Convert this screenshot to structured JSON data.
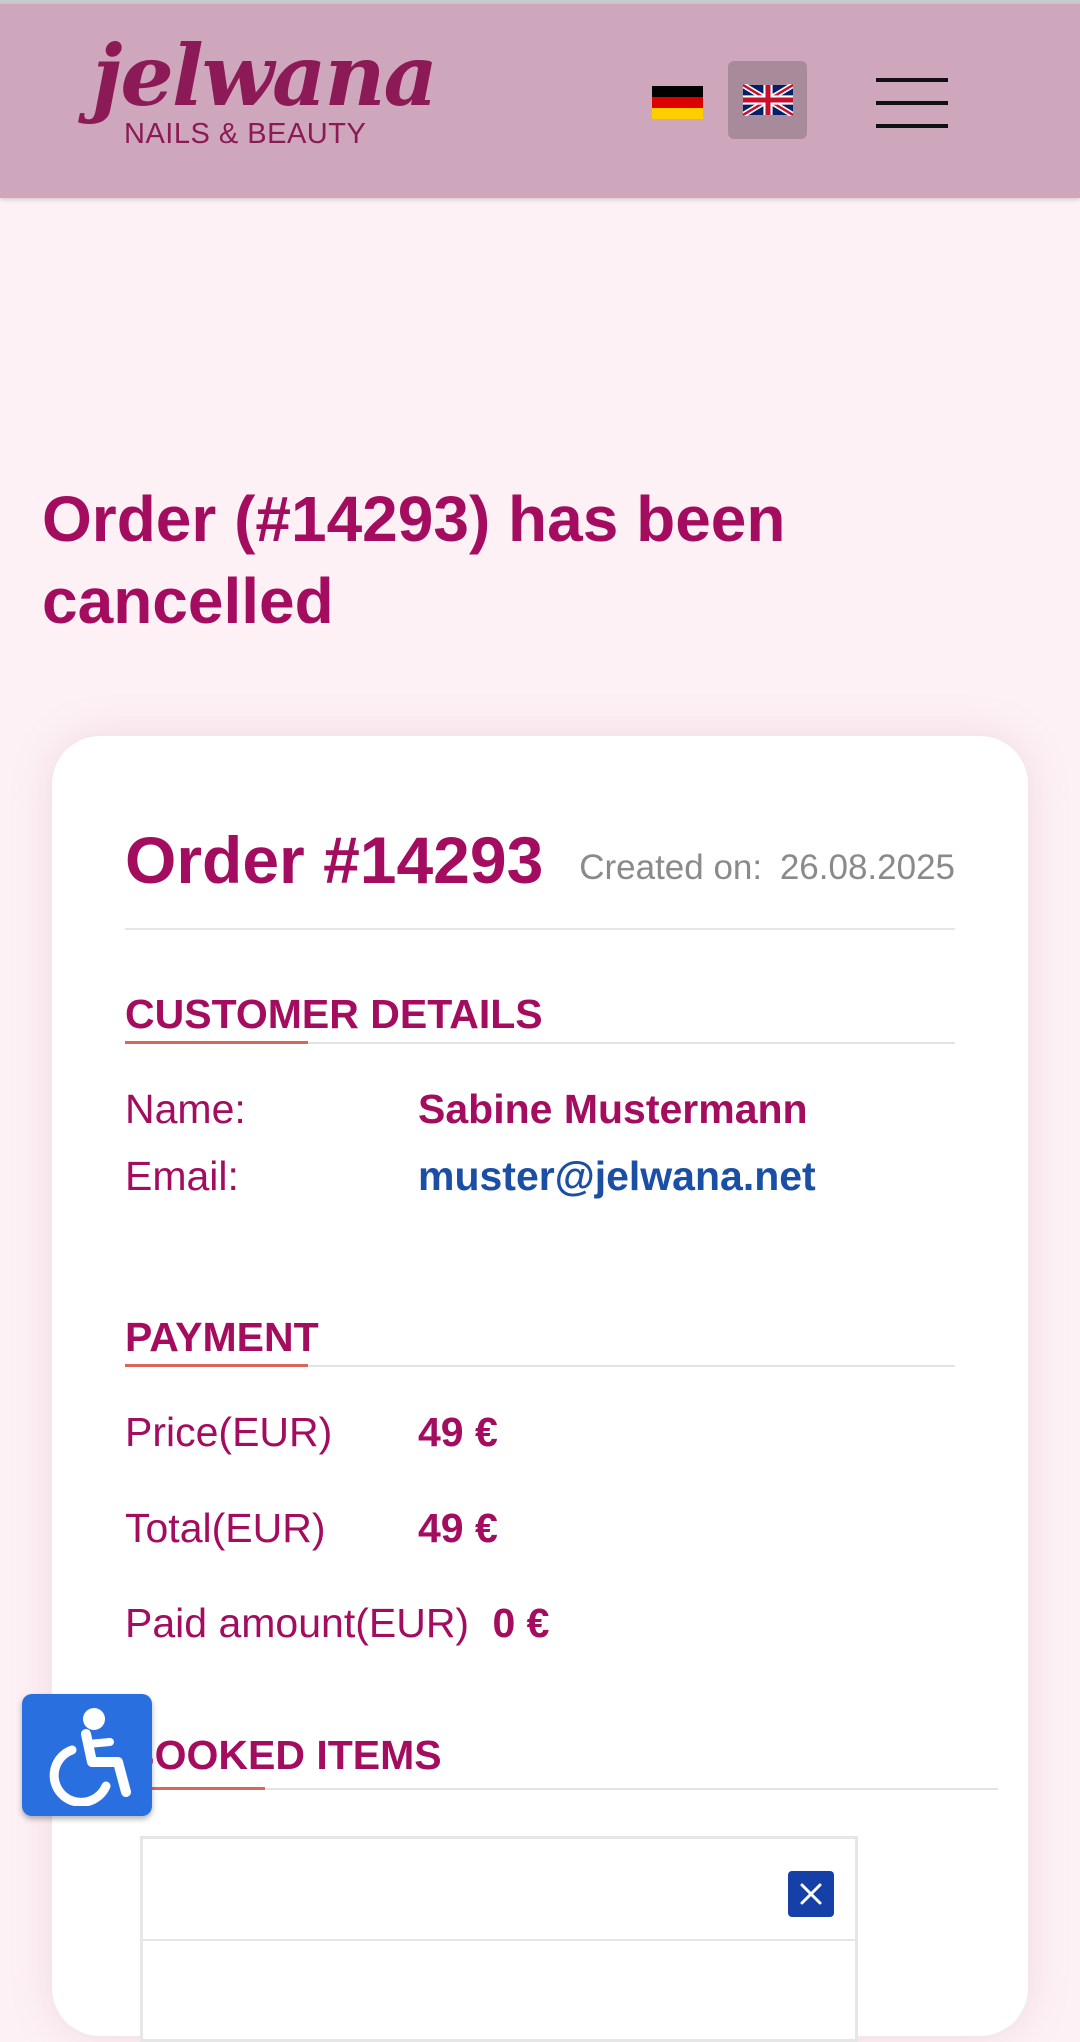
{
  "header": {
    "logo_word": "jelwana",
    "logo_sub": "NAILS & BEAUTY",
    "languages": [
      "german-flag",
      "english-flag"
    ],
    "active_language": "english-flag",
    "menu_icon": "hamburger-menu-icon"
  },
  "page": {
    "title": "Order (#14293) has been cancelled"
  },
  "order": {
    "number": "Order #14293",
    "created_label": "Created on:",
    "created_date": "26.08.2025"
  },
  "customer": {
    "section_title": "CUSTOMER DETAILS",
    "name_label": "Name:",
    "name_value": "Sabine Mustermann",
    "email_label": "Email:",
    "email_value": "muster@jelwana.net"
  },
  "payment": {
    "section_title": "PAYMENT",
    "price_label": "Price(EUR)",
    "price_value": "49 €",
    "total_label": "Total(EUR)",
    "total_value": "49 €",
    "paid_label": "Paid amount(EUR)",
    "paid_value": "0 €"
  },
  "booked": {
    "section_title": "BOOKED ITEMS"
  },
  "colors": {
    "header_bg": "#cfa7bd",
    "brand": "#a30c5f",
    "link": "#1b4fa5",
    "accent_line": "#d9665d",
    "page_bg": "#fdf1f5"
  },
  "widgets": {
    "accessibility_icon": "wheelchair-accessibility-icon",
    "close_icon": "close-icon"
  }
}
